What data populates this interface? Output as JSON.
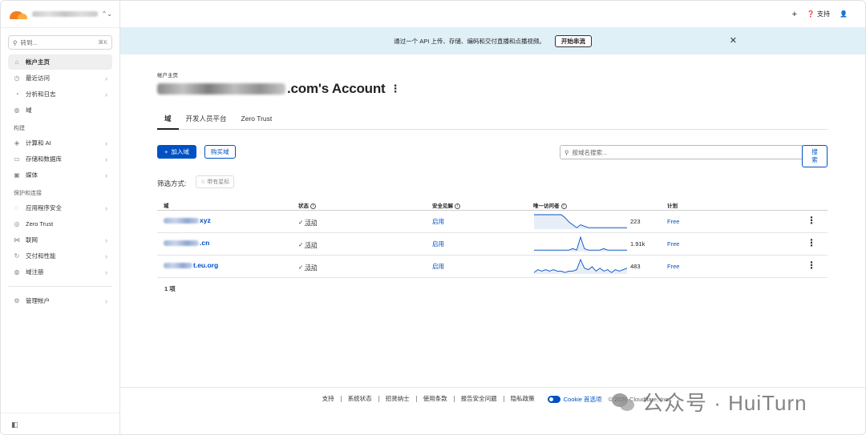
{
  "sidebar": {
    "search_placeholder": "转到...",
    "search_shortcut": "⌘K",
    "items_top": [
      {
        "label": "帐户主页",
        "icon": "home-icon",
        "glyph": "⌂",
        "active": true,
        "chevron": false
      },
      {
        "label": "最近访问",
        "icon": "clock-icon",
        "glyph": "◷",
        "active": false,
        "chevron": true
      },
      {
        "label": "分析和日志",
        "icon": "chart-icon",
        "glyph": "◔",
        "active": false,
        "chevron": true
      },
      {
        "label": "域",
        "icon": "globe-icon",
        "glyph": "◍",
        "active": false,
        "chevron": false
      }
    ],
    "section_build": "构建",
    "items_build": [
      {
        "label": "计算和 AI",
        "icon": "compute-icon",
        "glyph": "◈",
        "chevron": true
      },
      {
        "label": "存储和数据库",
        "icon": "storage-icon",
        "glyph": "▭",
        "chevron": true
      },
      {
        "label": "媒体",
        "icon": "media-icon",
        "glyph": "▣",
        "chevron": true
      }
    ],
    "section_protect": "保护和连接",
    "items_protect": [
      {
        "label": "应用程序安全",
        "icon": "shield-icon",
        "glyph": "◌",
        "chevron": true
      },
      {
        "label": "Zero Trust",
        "icon": "zero-trust-icon",
        "glyph": "◎",
        "chevron": false
      },
      {
        "label": "联网",
        "icon": "network-icon",
        "glyph": "⋈",
        "chevron": true
      },
      {
        "label": "交付和性能",
        "icon": "delivery-icon",
        "glyph": "↻",
        "chevron": true
      },
      {
        "label": "域注册",
        "icon": "registrar-icon",
        "glyph": "◍",
        "chevron": true
      }
    ],
    "manage_account": "管理帐户"
  },
  "topbar": {
    "support_label": "支持"
  },
  "banner": {
    "text": "通过一个 API 上传、存储、编码和交付直播和点播视频。",
    "button_label": "开始串流"
  },
  "main": {
    "breadcrumb": "帐户主页",
    "title_suffix": ".com's Account",
    "tabs": [
      "域",
      "开发人员平台",
      "Zero Trust"
    ],
    "add_domain_label": "加入域",
    "buy_domain_label": "购买域",
    "search_placeholder": "按域名搜索...",
    "search_button": "搜索",
    "filter_label": "筛选方式:",
    "filter_starred": "带有星标",
    "count_text": "1 项"
  },
  "table": {
    "headers": {
      "domain": "域",
      "status": "状态",
      "insights": "安全见解",
      "visitors": "唯一访问者",
      "plan": "计划"
    },
    "rows": [
      {
        "domain_suffix": "xyz",
        "blur_w": 44,
        "status": "活动",
        "insight": "启用",
        "visitors": "223",
        "plan": "Free",
        "spark": [
          10,
          10,
          10,
          10,
          10,
          10,
          10,
          10,
          8,
          5,
          3,
          1,
          3,
          2,
          1,
          1,
          1,
          1,
          1,
          1,
          1,
          1,
          1,
          1,
          1
        ]
      },
      {
        "domain_suffix": ".cn",
        "blur_w": 44,
        "status": "活动",
        "insight": "启用",
        "visitors": "1.91k",
        "plan": "Free",
        "spark": [
          1,
          1,
          1,
          1,
          1,
          1,
          1,
          1,
          1,
          1,
          2,
          1,
          10,
          2,
          1,
          1,
          1,
          1,
          2,
          1,
          1,
          1,
          1,
          1,
          1
        ]
      },
      {
        "domain_suffix": "t.eu.org",
        "blur_w": 36,
        "status": "活动",
        "insight": "启用",
        "visitors": "483",
        "plan": "Free",
        "spark": [
          1,
          3,
          2,
          3,
          2,
          3,
          2,
          2,
          1,
          2,
          2,
          3,
          10,
          4,
          3,
          5,
          2,
          4,
          2,
          3,
          1,
          3,
          2,
          3,
          4
        ]
      }
    ]
  },
  "footer": {
    "links": [
      "支持",
      "系统状态",
      "招贤纳士",
      "使用条款",
      "报告安全问题",
      "隐私政策"
    ],
    "cookie": "Cookie 首选项",
    "copyright": "© 2026 Cloudflare, Inc."
  },
  "watermark": "公众号 · HuiTurn",
  "colors": {
    "accent": "#0051c3",
    "banner_bg": "#dff0f7",
    "cloudflare_orange": "#f38020"
  }
}
